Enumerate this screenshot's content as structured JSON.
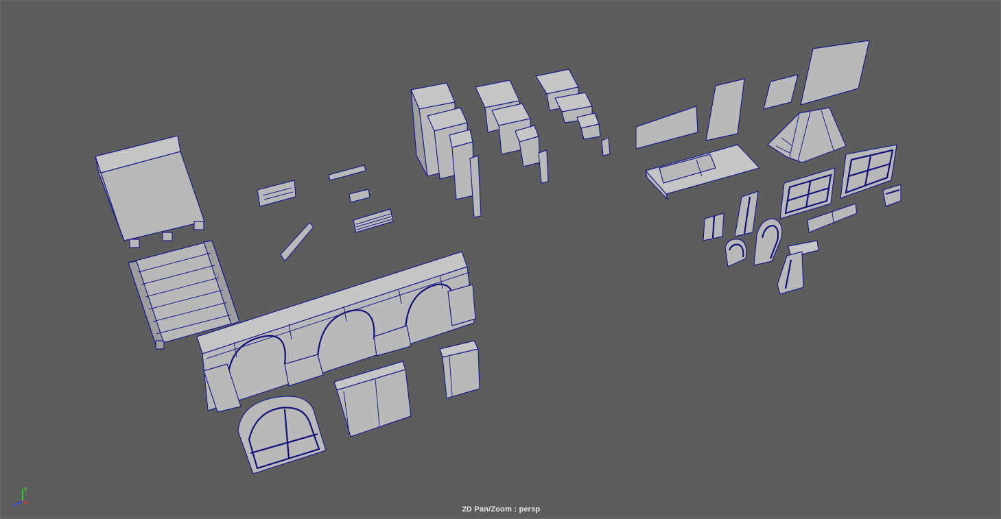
{
  "viewport": {
    "hud_label": "2D Pan/Zoom : persp",
    "background_color": "#5d5d5d",
    "wireframe_color": "#1c1c8a",
    "surface_color": "#b9b9b9"
  },
  "axis_gizmo": {
    "y_label": "y",
    "x_color": "#e03030",
    "y_color": "#40c040",
    "z_color": "#3050e0"
  }
}
